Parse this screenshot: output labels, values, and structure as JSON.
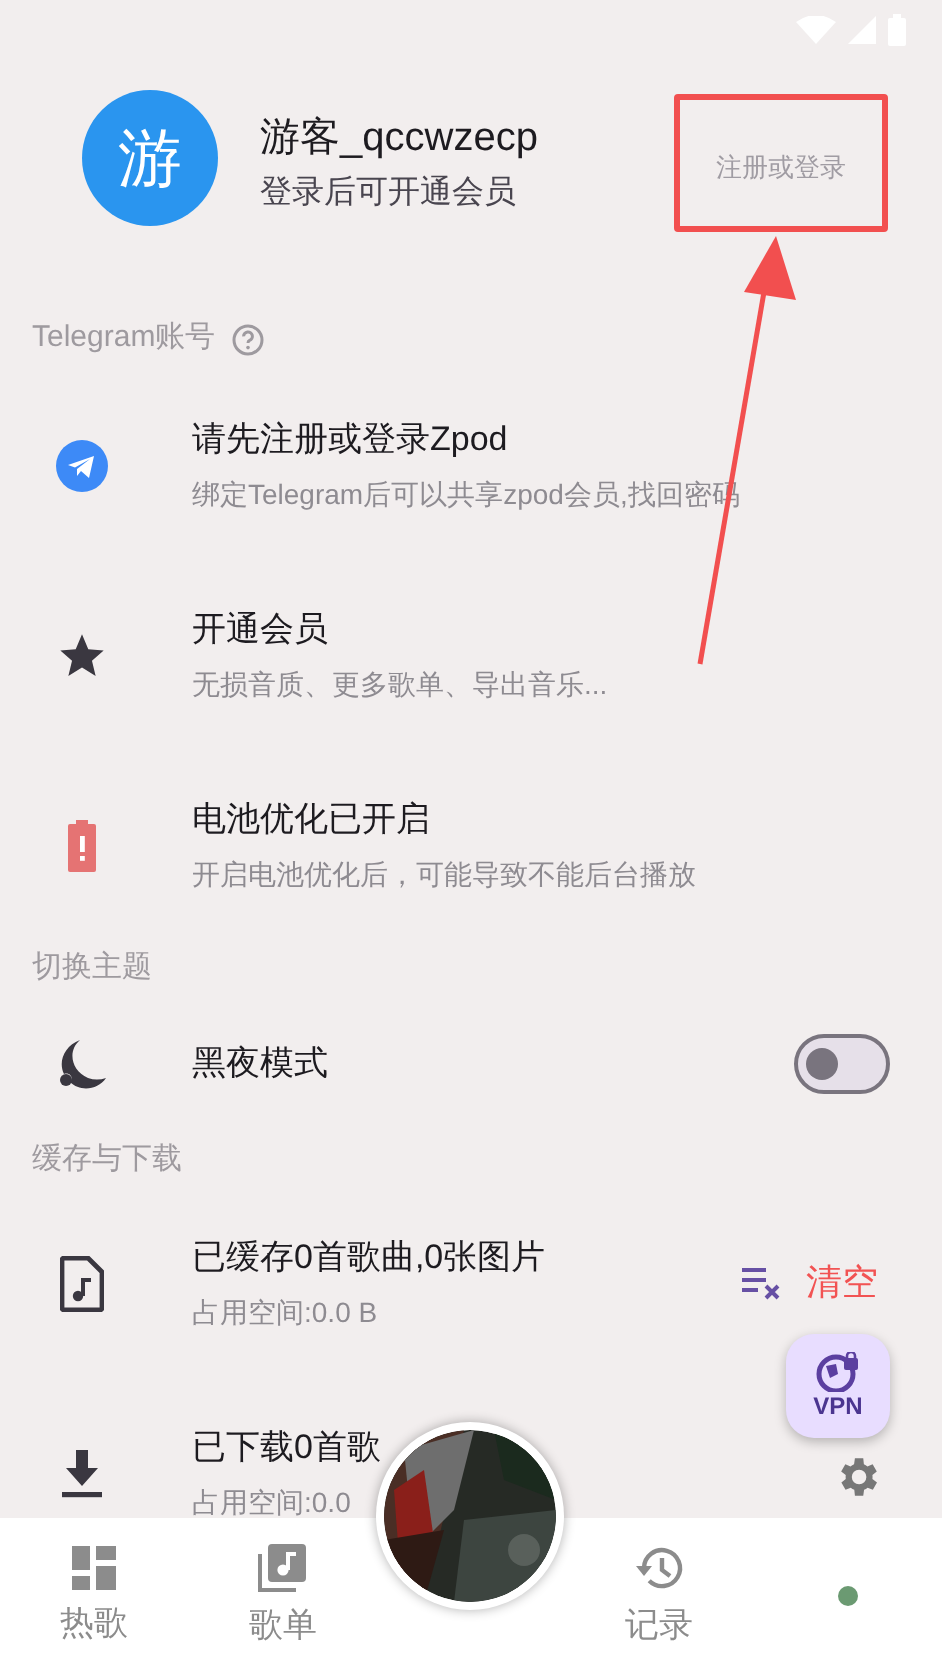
{
  "profile": {
    "avatar_text": "游",
    "name": "游客_qccwzecp",
    "subtitle": "登录后可开通会员",
    "login_button": "注册或登录"
  },
  "sections": [
    {
      "title": "Telegram账号",
      "has_help": true,
      "items": [
        {
          "kind": "telegram",
          "title": "请先注册或登录Zpod",
          "subtitle": "绑定Telegram后可以共享zpod会员,找回密码"
        },
        {
          "kind": "membership",
          "title": "开通会员",
          "subtitle": "无损音质、更多歌单、导出音乐..."
        },
        {
          "kind": "battery",
          "title": "电池优化已开启",
          "subtitle": "开启电池优化后，可能导致不能后台播放"
        }
      ]
    },
    {
      "title": "切换主题",
      "has_help": false,
      "items": [
        {
          "kind": "darkmode",
          "title": "黑夜模式",
          "on": false
        }
      ]
    },
    {
      "title": "缓存与下载",
      "has_help": false,
      "items": [
        {
          "kind": "cache",
          "title": "已缓存0首歌曲,0张图片",
          "subtitle": "占用空间:0.0 B",
          "action": "清空"
        },
        {
          "kind": "download",
          "title": "已下载0首歌",
          "subtitle": "占用空间:0.0"
        }
      ]
    }
  ],
  "fab": {
    "label": "VPN"
  },
  "nav": [
    {
      "kind": "hot",
      "label": "热歌"
    },
    {
      "kind": "playlists",
      "label": "歌单"
    },
    {
      "kind": "player"
    },
    {
      "kind": "history",
      "label": "记录"
    },
    {
      "kind": "profile"
    }
  ]
}
